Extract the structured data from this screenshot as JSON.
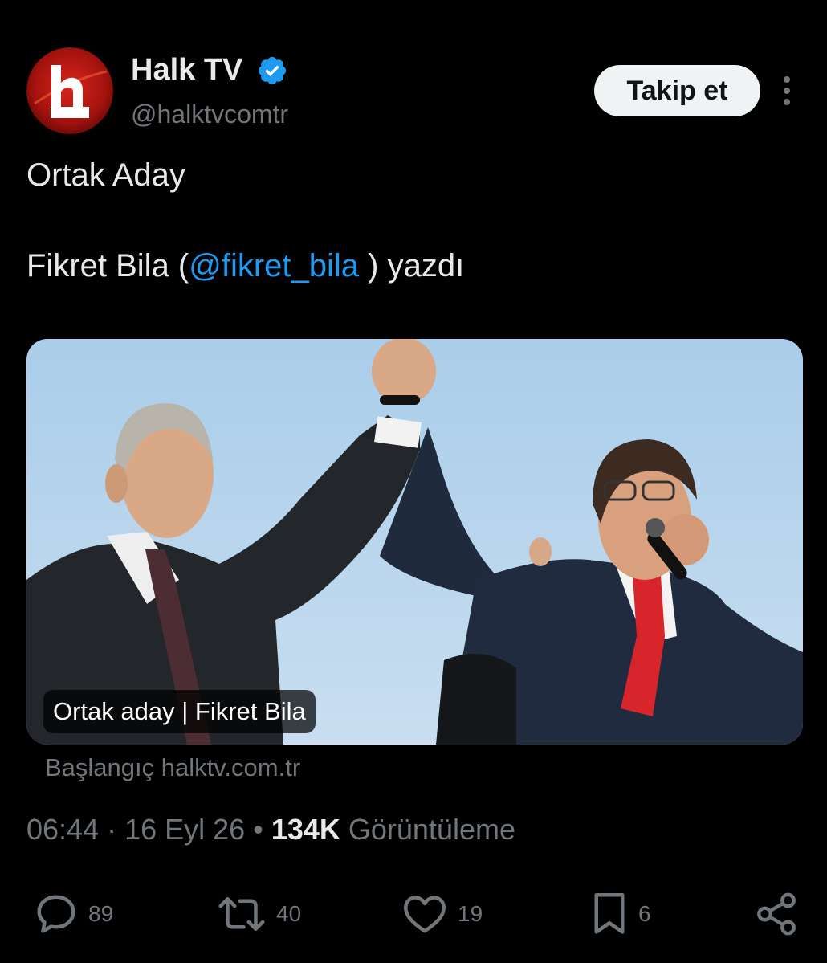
{
  "author": {
    "display_name": "Halk TV",
    "handle": "@halktvcomtr",
    "avatar_text": "halk",
    "verified": true,
    "badge_color": "#1d9bf0"
  },
  "header": {
    "follow_label": "Takip et",
    "more_icon": "more-vertical-icon"
  },
  "tweet": {
    "title": "Ortak Aday",
    "line_prefix": "Fikret Bila (",
    "mention": "@fikret_bila",
    "line_suffix": " ) yazdı",
    "mention_color": "#1d9bf0"
  },
  "card": {
    "caption": "Ortak aday | Fikret Bila",
    "source": "Başlangıç halktv.com.tr"
  },
  "meta": {
    "time": "06:44",
    "separator": " · ",
    "date": "16 Eyl 26",
    "dot": " • ",
    "views": "134K",
    "views_label": " Görüntüleme"
  },
  "actions": {
    "replies": "89",
    "retweets": "40",
    "likes": "19",
    "bookmarks": "6"
  },
  "colors": {
    "background": "#000000",
    "text": "#e7e9ea",
    "secondary": "#71767b",
    "accent": "#1d9bf0"
  }
}
